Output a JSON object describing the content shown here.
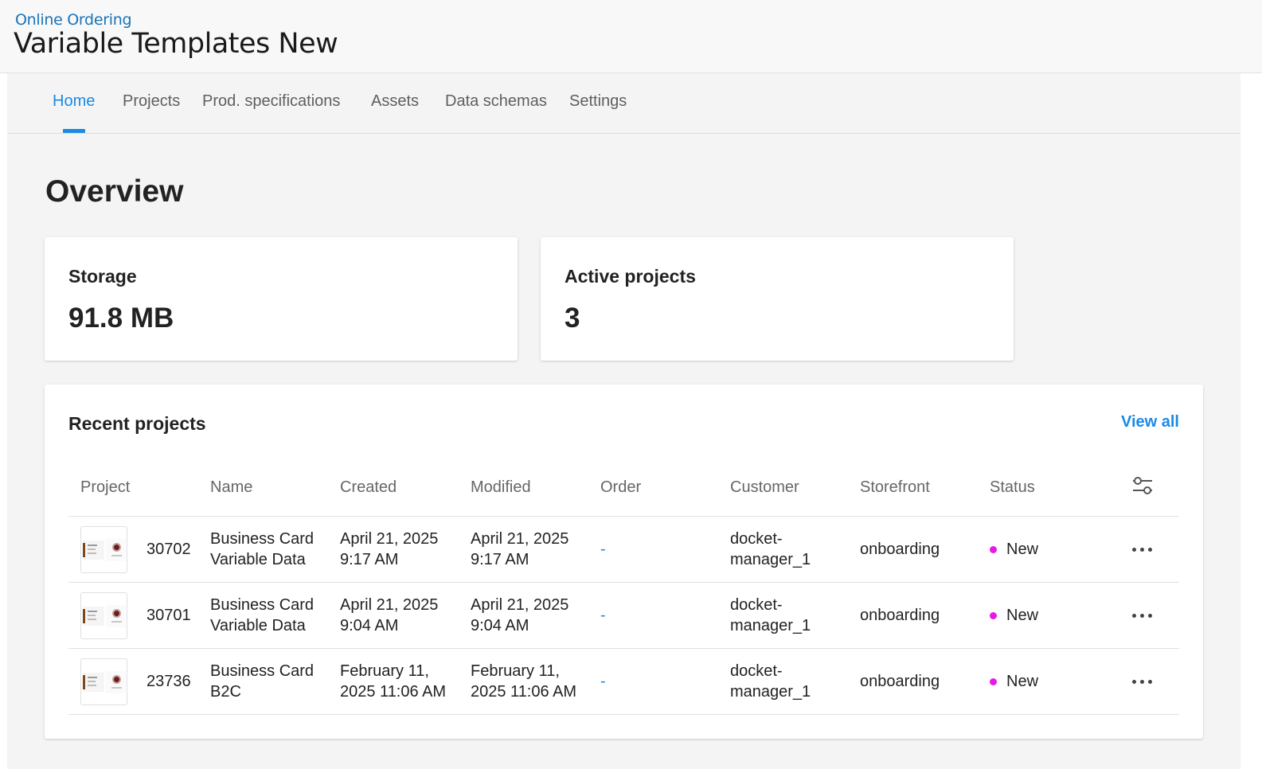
{
  "header": {
    "breadcrumb": "Online Ordering",
    "title": "Variable Templates New"
  },
  "tabs": [
    {
      "label": "Home",
      "active": true
    },
    {
      "label": "Projects",
      "active": false
    },
    {
      "label": "Prod. specifications",
      "active": false
    },
    {
      "label": "Assets",
      "active": false
    },
    {
      "label": "Data schemas",
      "active": false
    },
    {
      "label": "Settings",
      "active": false
    }
  ],
  "overview": {
    "title": "Overview",
    "storage": {
      "label": "Storage",
      "value": "91.8 MB"
    },
    "active_projects": {
      "label": "Active projects",
      "value": "3"
    }
  },
  "recent": {
    "title": "Recent projects",
    "view_all": "View all",
    "columns": {
      "project": "Project",
      "name": "Name",
      "created": "Created",
      "modified": "Modified",
      "order": "Order",
      "customer": "Customer",
      "storefront": "Storefront",
      "status": "Status"
    },
    "rows": [
      {
        "id": "30702",
        "name_line1": "Business Card",
        "name_line2": "Variable Data",
        "created_line1": "April 21, 2025",
        "created_line2": "9:17 AM",
        "modified_line1": "April 21, 2025",
        "modified_line2": "9:17 AM",
        "order": "-",
        "customer_line1": "docket-",
        "customer_line2": "manager_1",
        "storefront": "onboarding",
        "status": "New"
      },
      {
        "id": "30701",
        "name_line1": "Business Card",
        "name_line2": "Variable Data",
        "created_line1": "April 21, 2025",
        "created_line2": "9:04 AM",
        "modified_line1": "April 21, 2025",
        "modified_line2": "9:04 AM",
        "order": "-",
        "customer_line1": "docket-",
        "customer_line2": "manager_1",
        "storefront": "onboarding",
        "status": "New"
      },
      {
        "id": "23736",
        "name_line1": "Business Card",
        "name_line2": "B2C",
        "created_line1": "February 11,",
        "created_line2": "2025 11:06 AM",
        "modified_line1": "February 11,",
        "modified_line2": "2025 11:06 AM",
        "order": "-",
        "customer_line1": "docket-",
        "customer_line2": "manager_1",
        "storefront": "onboarding",
        "status": "New"
      }
    ]
  },
  "icons": {
    "column_settings": "sliders-icon",
    "row_menu": "more-horizontal-icon"
  },
  "colors": {
    "accent": "#1a8ae6",
    "breadcrumb": "#1a73b8",
    "status_new": "#e619e6"
  }
}
